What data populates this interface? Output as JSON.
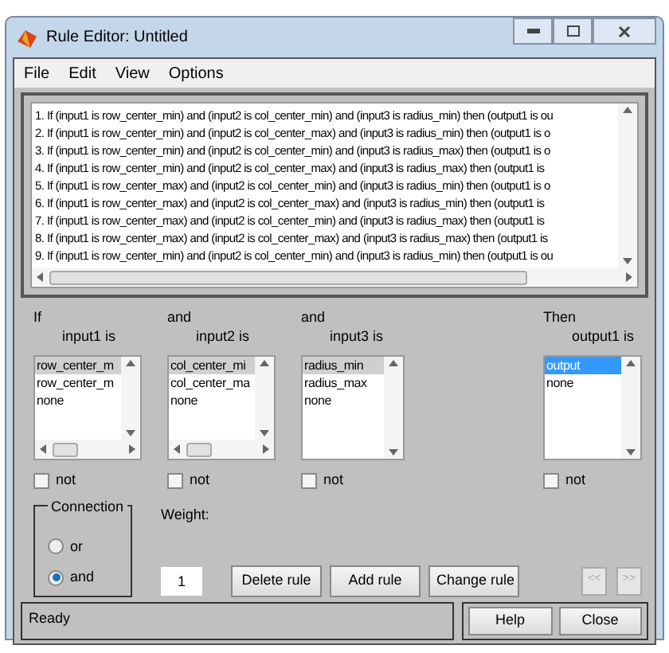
{
  "window": {
    "title": "Rule Editor: Untitled"
  },
  "menu": [
    "File",
    "Edit",
    "View",
    "Options"
  ],
  "rules": [
    "1. If (input1 is row_center_min) and (input2 is col_center_min) and (input3 is radius_min) then (output1 is ou",
    "2. If (input1 is row_center_min) and (input2 is col_center_max) and (input3 is radius_min) then (output1 is o",
    "3. If (input1 is row_center_min) and (input2 is col_center_min) and (input3 is radius_max) then (output1 is o",
    "4. If (input1 is row_center_min) and (input2 is col_center_max) and (input3 is radius_max) then (output1 is",
    "5. If (input1 is row_center_max) and (input2 is col_center_min) and (input3 is radius_min) then (output1 is o",
    "6. If (input1 is row_center_max) and (input2 is col_center_max) and (input3 is radius_min) then (output1 is",
    "7. If (input1 is row_center_max) and (input2 is col_center_min) and (input3 is radius_max) then (output1 is",
    "8. If (input1 is row_center_max) and (input2 is col_center_max) and (input3 is radius_max) then (output1 is",
    "9. If (input1 is row_center_min) and (input2 is col_center_min) and (input3 is radius_min) then (output1 is ou"
  ],
  "variables": [
    {
      "connector": "If",
      "label": "input1 is",
      "focused": false,
      "hscroll": true,
      "items": [
        {
          "text": "row_center_m",
          "selected": true
        },
        {
          "text": "row_center_m",
          "selected": false
        },
        {
          "text": "none",
          "selected": false
        }
      ],
      "not": {
        "label": "not",
        "checked": false
      }
    },
    {
      "connector": "and",
      "label": "input2 is",
      "focused": false,
      "hscroll": true,
      "items": [
        {
          "text": "col_center_mi",
          "selected": true
        },
        {
          "text": "col_center_ma",
          "selected": false
        },
        {
          "text": "none",
          "selected": false
        }
      ],
      "not": {
        "label": "not",
        "checked": false
      }
    },
    {
      "connector": "and",
      "label": "input3 is",
      "focused": false,
      "hscroll": false,
      "items": [
        {
          "text": "radius_min",
          "selected": true
        },
        {
          "text": "radius_max",
          "selected": false
        },
        {
          "text": "none",
          "selected": false
        }
      ],
      "not": {
        "label": "not",
        "checked": false
      }
    }
  ],
  "output": {
    "connector": "Then",
    "label": "output1 is",
    "focused": true,
    "hscroll": false,
    "items": [
      {
        "text": "output",
        "selected": true
      },
      {
        "text": "none",
        "selected": false
      }
    ],
    "not": {
      "label": "not",
      "checked": false
    }
  },
  "connection": {
    "title": "Connection",
    "options": [
      {
        "label": "or",
        "selected": false
      },
      {
        "label": "and",
        "selected": true
      }
    ]
  },
  "weight": {
    "label": "Weight:",
    "value": "1"
  },
  "buttons": [
    "Delete rule",
    "Add rule",
    "Change rule"
  ],
  "nav": [
    {
      "label": "<<",
      "disabled": true
    },
    {
      "label": ">>",
      "disabled": true
    }
  ],
  "status": "Ready",
  "footer_buttons": [
    "Help",
    "Close"
  ]
}
